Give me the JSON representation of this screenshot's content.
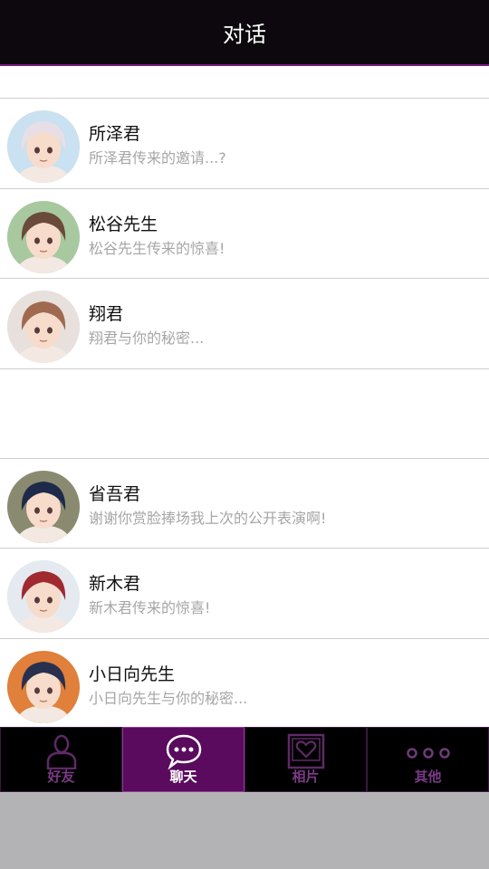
{
  "header": {
    "title": "对话"
  },
  "conversations": [
    {
      "name": "所泽君",
      "preview": "所泽君传来的邀请...?",
      "hair": "#e8dfe6",
      "bg": "#c9e1f0"
    },
    {
      "name": "松谷先生",
      "preview": "松谷先生传来的惊喜!",
      "hair": "#6a4a3a",
      "bg": "#a8c8a0"
    },
    {
      "name": "翔君",
      "preview": "翔君与你的秘密...",
      "hair": "#a06a50",
      "bg": "#e8e0dc"
    },
    {
      "name": "省吾君",
      "preview": "谢谢你赏脸捧场我上次的公开表演啊!",
      "hair": "#1e2a4a",
      "bg": "#8a8a70"
    },
    {
      "name": "新木君",
      "preview": "新木君传来的惊喜!",
      "hair": "#a02a30",
      "bg": "#e4eaf0"
    },
    {
      "name": "小日向先生",
      "preview": "小日向先生与你的秘密...",
      "hair": "#283050",
      "bg": "#e0803a"
    }
  ],
  "tabs": [
    {
      "label": "好友",
      "icon": "person-icon",
      "active": false
    },
    {
      "label": "聊天",
      "icon": "chat-bubble-icon",
      "active": true
    },
    {
      "label": "相片",
      "icon": "heart-photo-icon",
      "active": false
    },
    {
      "label": "其他",
      "icon": "more-dots-icon",
      "active": false
    }
  ],
  "colors": {
    "accent": "#5a0b5e",
    "header_bg": "#0c080d",
    "preview_text": "#a6a6a6"
  }
}
